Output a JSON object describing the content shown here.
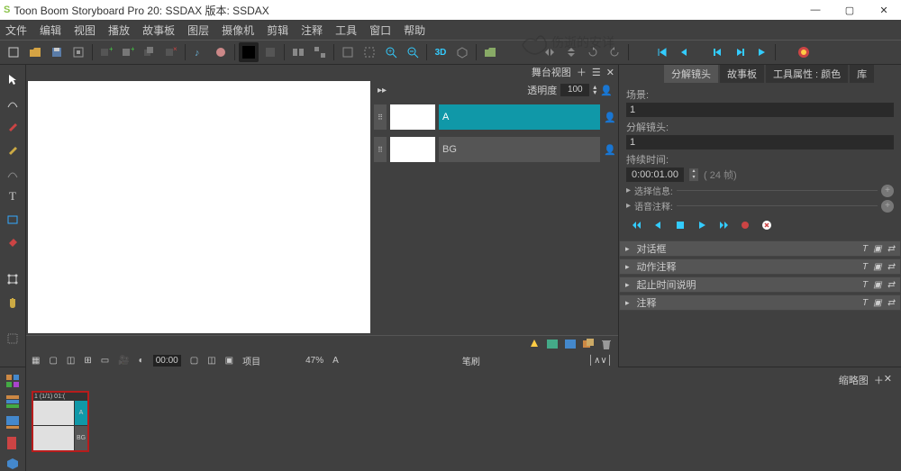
{
  "title": "Toon Boom Storyboard Pro 20:   SSDAX 版本: SSDAX",
  "menu": [
    "文件",
    "编辑",
    "视图",
    "播放",
    "故事板",
    "图层",
    "摄像机",
    "剪辑",
    "注释",
    "工具",
    "窗口",
    "帮助"
  ],
  "stage": {
    "panel_name": "舞台视图",
    "opacity_label": "透明度",
    "opacity_value": "100",
    "layers": [
      {
        "name": "A",
        "selected": true
      },
      {
        "name": "BG",
        "selected": false
      }
    ],
    "project_label": "项目",
    "zoom": "47%",
    "layer_current": "A",
    "brush_label": "笔刷"
  },
  "right": {
    "tabs": [
      "分解镜头",
      "故事板",
      "工具属性 : 颜色",
      "库"
    ],
    "active_tab": 0,
    "scene_label": "场景:",
    "scene_value": "1",
    "panel_label": "分解镜头:",
    "panel_value": "1",
    "duration_label": "持续时间:",
    "duration_value": "0:00:01.00",
    "frames_text": "( 24 帧)",
    "select_info": "选择信息:",
    "voice_note": "语音注释:",
    "collapsibles": [
      "对话框",
      "动作注释",
      "起止时间说明",
      "注释"
    ]
  },
  "thumbs": {
    "header": "缩略图",
    "panel_id": "1 (1/1) 01:(",
    "layer_a": "A",
    "layer_bg": "BG"
  },
  "watermark": "伤逝的安详"
}
